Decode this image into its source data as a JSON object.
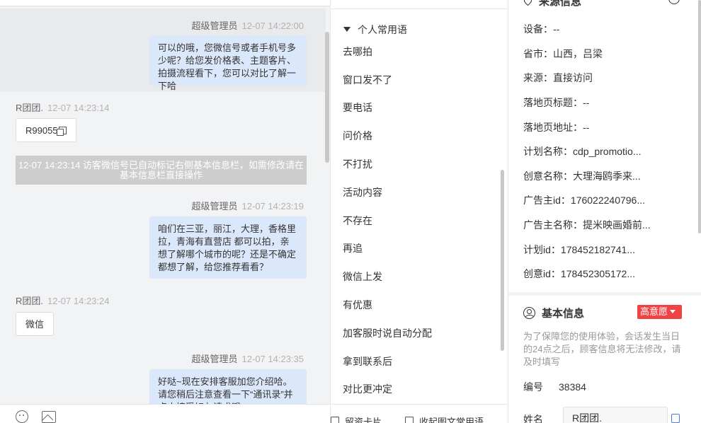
{
  "chat": {
    "messages": [
      {
        "sender": "超级管理员",
        "time": "12-07 14:22:00",
        "text": "可以的哦，您微信号或者手机号多少呢？给您发价格表、主题客片、拍摄流程看下，您可以对比了解一下哈"
      },
      {
        "sender": "R团团.",
        "time": "12-07 14:23:14",
        "text": "R99055"
      },
      {
        "system": "12-07 14:23:14 访客微信号已自动标记右侧基本信息栏，如需修改请在基本信息栏直接操作"
      },
      {
        "sender": "超级管理员",
        "time": "12-07 14:23:19",
        "text": "咱们在三亚，丽江，大理，香格里拉，青海有直营店 都可以拍，亲想了解哪个城市的呢？还是不确定都想了解，给您推荐看看？"
      },
      {
        "sender": "R团团.",
        "time": "12-07 14:23:24",
        "text": "微信"
      },
      {
        "sender": "超级管理员",
        "time": "12-07 14:23:35",
        "text": "好哒~现在安排客服加您介绍哈。请您稍后注意查看一下“通讯录”并点击接受好友请求哦"
      }
    ]
  },
  "phrases": {
    "group": "个人常用语",
    "items": [
      "去哪拍",
      "窗口发不了",
      "要电话",
      "问价格",
      "不打扰",
      "活动内容",
      "不存在",
      "再追",
      "微信上发",
      "有优惠",
      "加客服时说自动分配",
      "拿到联系后",
      "对比更冲定"
    ],
    "btn_card": "留资卡片",
    "btn_collapse": "收起图文常用语"
  },
  "info": {
    "source_title": "来源信息",
    "rows": [
      {
        "label": "设备：",
        "value": "--"
      },
      {
        "label": "省市：",
        "value": "山西，吕梁"
      },
      {
        "label": "来源：",
        "value": "直接访问"
      },
      {
        "label": "落地页标题：",
        "value": "--"
      },
      {
        "label": "落地页地址：",
        "value": "--"
      },
      {
        "label": "计划名称：",
        "value": "cdp_promotio..."
      },
      {
        "label": "创意名称：",
        "value": "大理海鸥季来..."
      },
      {
        "label": "广告主id：",
        "value": "176022240796..."
      },
      {
        "label": "广告主名称：",
        "value": "提米映画婚前..."
      },
      {
        "label": "计划id：",
        "value": "178452182741..."
      },
      {
        "label": "创意id：",
        "value": "178452305172..."
      }
    ],
    "basic_title": "基本信息",
    "intent_badge": "高意愿",
    "hint": "为了保障您的使用体验，会话发生当日的24点之后，顾客信息将无法修改，请及时填写",
    "id_label": "编号",
    "id_value": "38384",
    "name_label": "姓名",
    "name_value": "R团团."
  },
  "colors": {
    "bubble_agent": "#dbe8fb",
    "badge": "#f04346",
    "chat_bg": "#f2f3f5"
  },
  "icons": [
    "emoji-icon",
    "image-icon",
    "location-pin-icon",
    "shield-icon",
    "user-circle-icon",
    "copy-icon",
    "document-icon",
    "edit-icon"
  ]
}
